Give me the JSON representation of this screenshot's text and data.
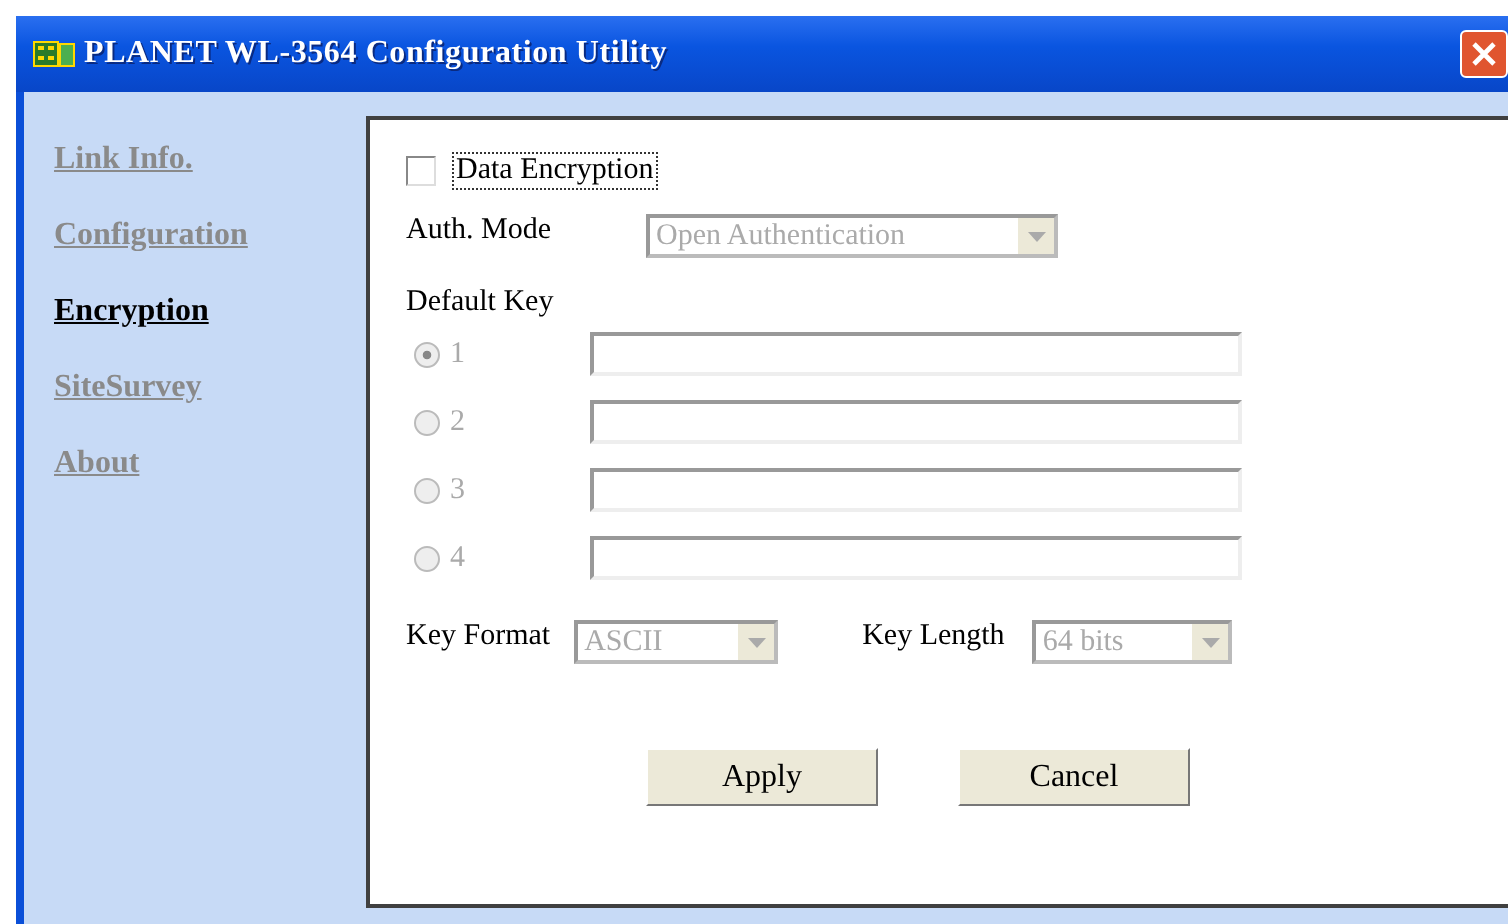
{
  "window": {
    "title": "PLANET WL-3564 Configuration Utility"
  },
  "sidebar": {
    "items": [
      {
        "label": "Link Info.",
        "selected": false
      },
      {
        "label": "Configuration",
        "selected": false
      },
      {
        "label": "Encryption",
        "selected": true
      },
      {
        "label": "SiteSurvey",
        "selected": false
      },
      {
        "label": "About",
        "selected": false
      }
    ]
  },
  "encryption": {
    "label": "Data Encryption",
    "checked": false,
    "disabled": true,
    "auth_mode": {
      "label": "Auth. Mode",
      "value": "Open Authentication"
    },
    "default_key": {
      "label": "Default Key",
      "keys": [
        {
          "label": "1",
          "selected": true
        },
        {
          "label": "2",
          "selected": false
        },
        {
          "label": "3",
          "selected": false
        },
        {
          "label": "4",
          "selected": false
        }
      ]
    },
    "key_format": {
      "label": "Key Format",
      "value": "ASCII"
    },
    "key_length": {
      "label": "Key Length",
      "value": "64 bits"
    }
  },
  "buttons": [
    {
      "label": "Apply"
    },
    {
      "label": "Cancel"
    }
  ]
}
